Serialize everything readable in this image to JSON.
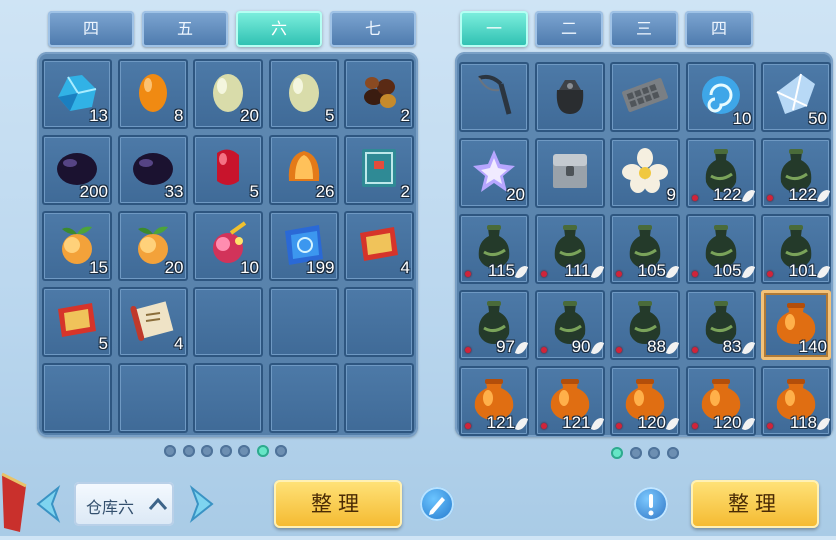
{
  "left_tabs": [
    {
      "label": "四",
      "active": false
    },
    {
      "label": "五",
      "active": false
    },
    {
      "label": "六",
      "active": true
    },
    {
      "label": "七",
      "active": false
    }
  ],
  "right_tabs": [
    {
      "label": "一",
      "active": true
    },
    {
      "label": "二",
      "active": false
    },
    {
      "label": "三",
      "active": false
    },
    {
      "label": "四",
      "active": false
    }
  ],
  "storage": {
    "items": [
      {
        "icon": "blue-crystal-ore-icon",
        "count": "13"
      },
      {
        "icon": "orange-gem-icon",
        "count": "8"
      },
      {
        "icon": "jade-egg-icon",
        "count": "20"
      },
      {
        "icon": "jade-egg-icon",
        "count": "5"
      },
      {
        "icon": "chestnut-seeds-icon",
        "count": "2"
      },
      {
        "icon": "black-pearl-icon",
        "count": "200"
      },
      {
        "icon": "black-pearl-icon",
        "count": "33"
      },
      {
        "icon": "red-gem-icon",
        "count": "5"
      },
      {
        "icon": "amber-shell-icon",
        "count": "26"
      },
      {
        "icon": "teal-book-icon",
        "count": "2"
      },
      {
        "icon": "peach-fruit-icon",
        "count": "15"
      },
      {
        "icon": "peach-fruit-icon",
        "count": "20"
      },
      {
        "icon": "magic-fruit-icon",
        "count": "10"
      },
      {
        "icon": "blue-spellbook-icon",
        "count": "199"
      },
      {
        "icon": "red-scroll-icon",
        "count": "4"
      },
      {
        "icon": "red-scroll-icon",
        "count": "5"
      },
      {
        "icon": "paper-scroll-icon",
        "count": "4"
      }
    ],
    "total_slots": 25,
    "page_dots": 7,
    "active_dot": 5,
    "warehouse_label": "仓库六",
    "sort_label": "整理"
  },
  "bag": {
    "items": [
      {
        "icon": "slingshot-icon",
        "count": ""
      },
      {
        "icon": "black-pouch-icon",
        "count": ""
      },
      {
        "icon": "metal-plate-icon",
        "count": ""
      },
      {
        "icon": "swirl-orb-icon",
        "count": "10"
      },
      {
        "icon": "ice-crystal-icon",
        "count": "50"
      },
      {
        "icon": "star-crystal-icon",
        "count": "20"
      },
      {
        "icon": "silver-chest-icon",
        "count": ""
      },
      {
        "icon": "white-flower-icon",
        "count": "9"
      },
      {
        "icon": "green-jar-icon",
        "count": "122",
        "bound": true
      },
      {
        "icon": "green-jar-icon",
        "count": "122",
        "bound": true
      },
      {
        "icon": "green-jar-icon",
        "count": "115",
        "bound": true
      },
      {
        "icon": "green-jar-icon",
        "count": "111",
        "bound": true
      },
      {
        "icon": "green-jar-icon",
        "count": "105",
        "bound": true
      },
      {
        "icon": "green-jar-icon",
        "count": "105",
        "bound": true
      },
      {
        "icon": "green-jar-icon",
        "count": "101",
        "bound": true
      },
      {
        "icon": "green-jar-icon",
        "count": "97",
        "bound": true
      },
      {
        "icon": "green-jar-icon",
        "count": "90",
        "bound": true
      },
      {
        "icon": "green-jar-icon",
        "count": "88",
        "bound": true
      },
      {
        "icon": "green-jar-icon",
        "count": "83",
        "bound": true
      },
      {
        "icon": "orange-jar-icon",
        "count": "140",
        "bound": false,
        "selected": true
      },
      {
        "icon": "orange-jar-icon",
        "count": "121",
        "bound": true
      },
      {
        "icon": "orange-jar-icon",
        "count": "121",
        "bound": true
      },
      {
        "icon": "orange-jar-icon",
        "count": "120",
        "bound": true
      },
      {
        "icon": "orange-jar-icon",
        "count": "120",
        "bound": true
      },
      {
        "icon": "orange-jar-icon",
        "count": "118",
        "bound": true
      }
    ],
    "page_dots": 4,
    "active_dot": 0,
    "sort_label": "整理"
  },
  "colors": {
    "accent": "#3fd3c1",
    "gold": "#f4b92f",
    "panel": "#557fa9"
  }
}
